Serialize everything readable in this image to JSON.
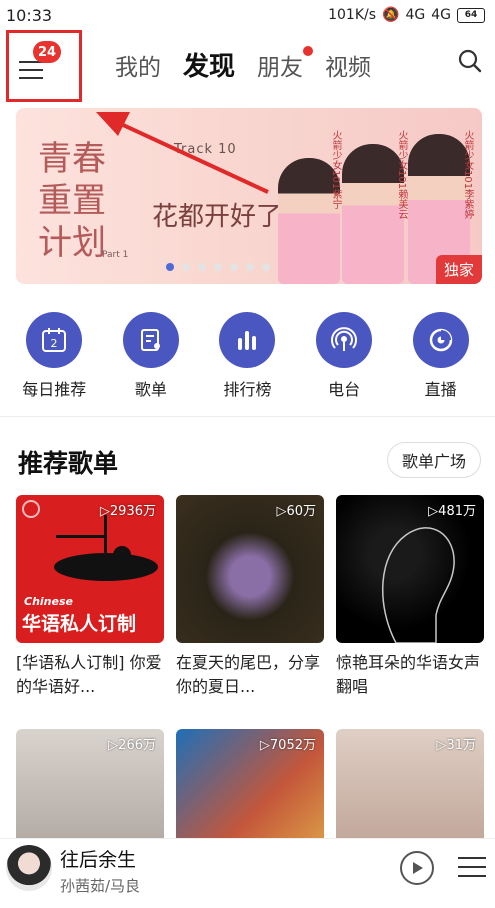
{
  "status_bar": {
    "time": "10:33",
    "network_speed": "101K/s",
    "signal_1": "4G",
    "signal_2": "4G",
    "battery": "64"
  },
  "nav": {
    "menu_badge": "24",
    "tabs": [
      {
        "label": "我的",
        "active": false,
        "dot": false
      },
      {
        "label": "发现",
        "active": true,
        "dot": false
      },
      {
        "label": "朋友",
        "active": false,
        "dot": true
      },
      {
        "label": "视频",
        "active": false,
        "dot": false
      }
    ]
  },
  "banner": {
    "headline": "青春重置计划",
    "track": "Track 10",
    "slogan": "花都开好了",
    "part": "Part 1",
    "tag": "独家",
    "credits": [
      "火箭少女101紫宁",
      "火箭少女101赖美云",
      "火箭少女101李紫婷"
    ],
    "page_count": 7,
    "active_page": 0
  },
  "quick_entries": [
    {
      "label": "每日推荐",
      "icon": "calendar-icon",
      "icon_text": "2"
    },
    {
      "label": "歌单",
      "icon": "playlist-icon"
    },
    {
      "label": "排行榜",
      "icon": "chart-icon"
    },
    {
      "label": "电台",
      "icon": "radio-icon"
    },
    {
      "label": "直播",
      "icon": "live-icon"
    }
  ],
  "section": {
    "title": "推荐歌单",
    "more_button": "歌单广场"
  },
  "playlists": [
    {
      "plays": "2936万",
      "title": "[华语私人订制] 你爱的华语好...",
      "cover_sub": "Chinese",
      "cover_main": "华语私人订制"
    },
    {
      "plays": "60万",
      "title": "在夏天的尾巴，分享你的夏日..."
    },
    {
      "plays": "481万",
      "title": "惊艳耳朵的华语女声翻唱"
    },
    {
      "plays": "266万",
      "title": ""
    },
    {
      "plays": "7052万",
      "title": ""
    },
    {
      "plays": "31万",
      "title": ""
    }
  ],
  "player": {
    "song": "往后余生",
    "artist": "孙茜茹/马良"
  },
  "colors": {
    "accent": "#4b57c0",
    "badge_red": "#e8322e",
    "annotation_red": "#e02a2a"
  }
}
